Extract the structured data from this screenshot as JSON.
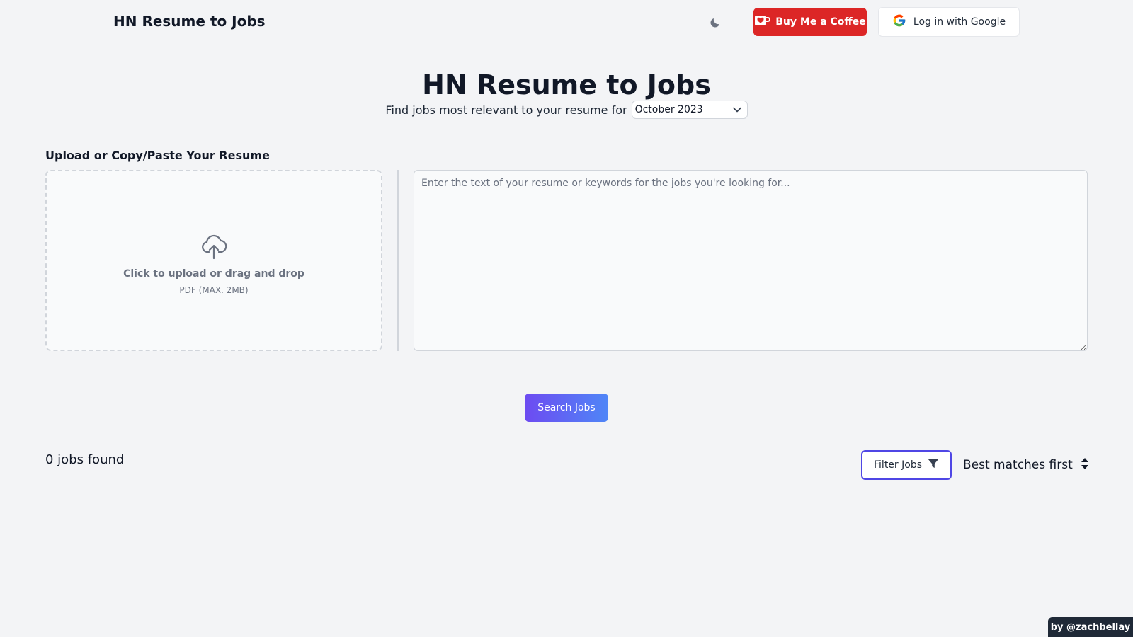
{
  "header": {
    "brand": "HN Resume to Jobs",
    "theme_toggle_icon": "moon-icon",
    "coffee_label": "Buy Me a Coffee",
    "google_label": "Log in with Google"
  },
  "hero": {
    "title": "HN Resume to Jobs",
    "subtitle": "Find jobs most relevant to your resume for",
    "month_selected": "October 2023"
  },
  "upload": {
    "section_label": "Upload or Copy/Paste Your Resume",
    "drop_main": "Click to upload or drag and drop",
    "drop_sub": "PDF (MAX. 2MB)",
    "textarea_placeholder": "Enter the text of your resume or keywords for the jobs you're looking for..."
  },
  "actions": {
    "search_label": "Search Jobs"
  },
  "results": {
    "count_text": "0 jobs found",
    "filter_label": "Filter Jobs",
    "sort_label": "Best matches first"
  },
  "footer": {
    "credit": "by @zachbellay"
  },
  "colors": {
    "accent": "#4f46e5",
    "coffee": "#dc2626",
    "background": "#f3f4f6"
  }
}
